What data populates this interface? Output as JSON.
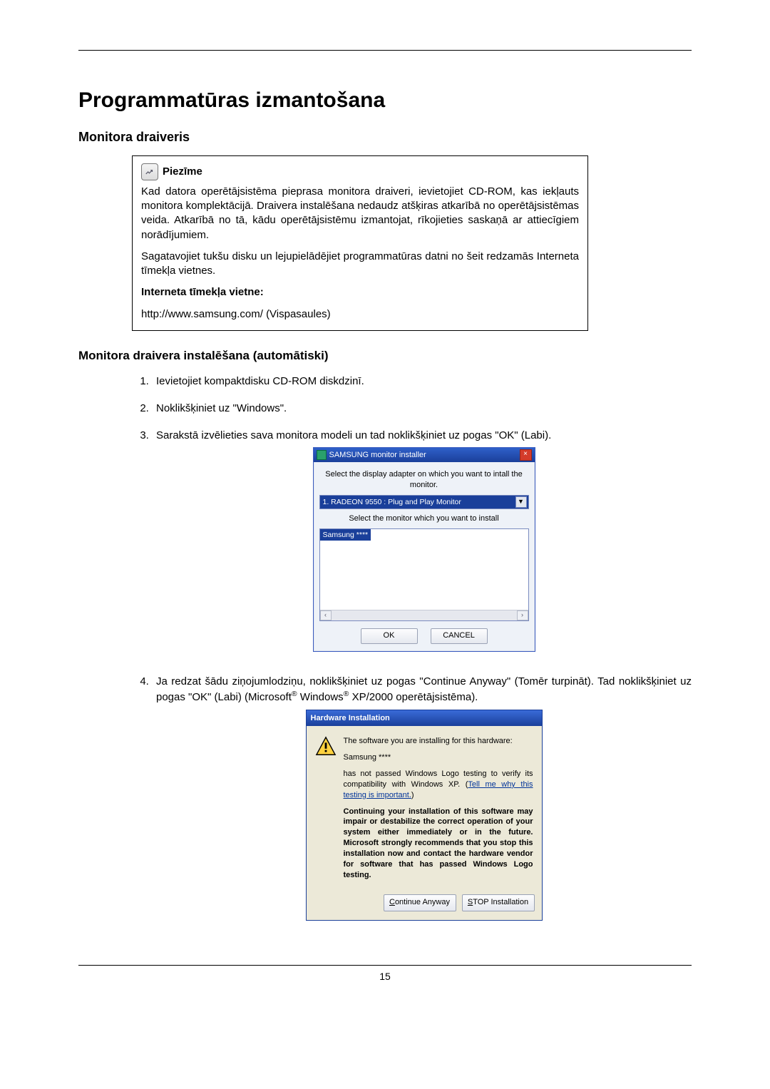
{
  "page_number": "15",
  "title": "Programmatūras izmantošana",
  "section1_heading": "Monitora draiveris",
  "note": {
    "label": "Piezīme",
    "p1": "Kad datora operētājsistēma pieprasa monitora draiveri, ievietojiet CD-ROM, kas iekļauts monitora komplektācijā. Draivera instalēšana nedaudz atšķiras atkarībā no operētājsistēmas veida. Atkarībā no tā, kādu operētājsistēmu izmantojat, rīkojieties saskaņā ar attiecīgiem norādījumiem.",
    "p2": "Sagatavojiet tukšu disku un lejupielādējiet programmatūras datni no šeit redzamās Interneta tīmekļa vietnes.",
    "p3_label": "Interneta tīmekļa vietne:",
    "p4": "http://www.samsung.com/ (Vispasaules)"
  },
  "section2_heading": "Monitora draivera instalēšana (automātiski)",
  "steps": {
    "s1": "Ievietojiet kompaktdisku CD-ROM diskdzinī.",
    "s2": "Noklikšķiniet uz \"Windows\".",
    "s3": "Sarakstā izvēlieties sava monitora modeli un tad noklikšķiniet uz pogas \"OK\" (Labi).",
    "s4_a": "Ja redzat šādu ziņojumlodziņu, noklikšķiniet uz pogas \"Continue Anyway\" (Tomēr turpināt). Tad noklikšķiniet uz pogas \"OK\" (Labi) (Microsoft",
    "s4_b": " Windows",
    "s4_c": " XP/2000 operētājsistēma)."
  },
  "installer": {
    "title": "SAMSUNG monitor installer",
    "label_top": "Select the display adapter on which you want to intall the monitor.",
    "combo_value": "1. RADEON 9550 : Plug and Play Monitor",
    "label_mid": "Select the monitor which you want to install",
    "selected_item": "Samsung ****",
    "btn_ok": "OK",
    "btn_cancel": "CANCEL"
  },
  "warning": {
    "title": "Hardware Installation",
    "line1": "The software you are installing for this hardware:",
    "line2": "Samsung ****",
    "line3a": "has not passed Windows Logo testing to verify its compatibility with Windows XP. (",
    "link": "Tell me why this testing is important.",
    "line3b": ")",
    "bold": "Continuing your installation of this software may impair or destabilize the correct operation of your system either immediately or in the future. Microsoft strongly recommends that you stop this installation now and contact the hardware vendor for software that has passed Windows Logo testing.",
    "btn_continue": "Continue Anyway",
    "btn_stop": "STOP Installation"
  }
}
